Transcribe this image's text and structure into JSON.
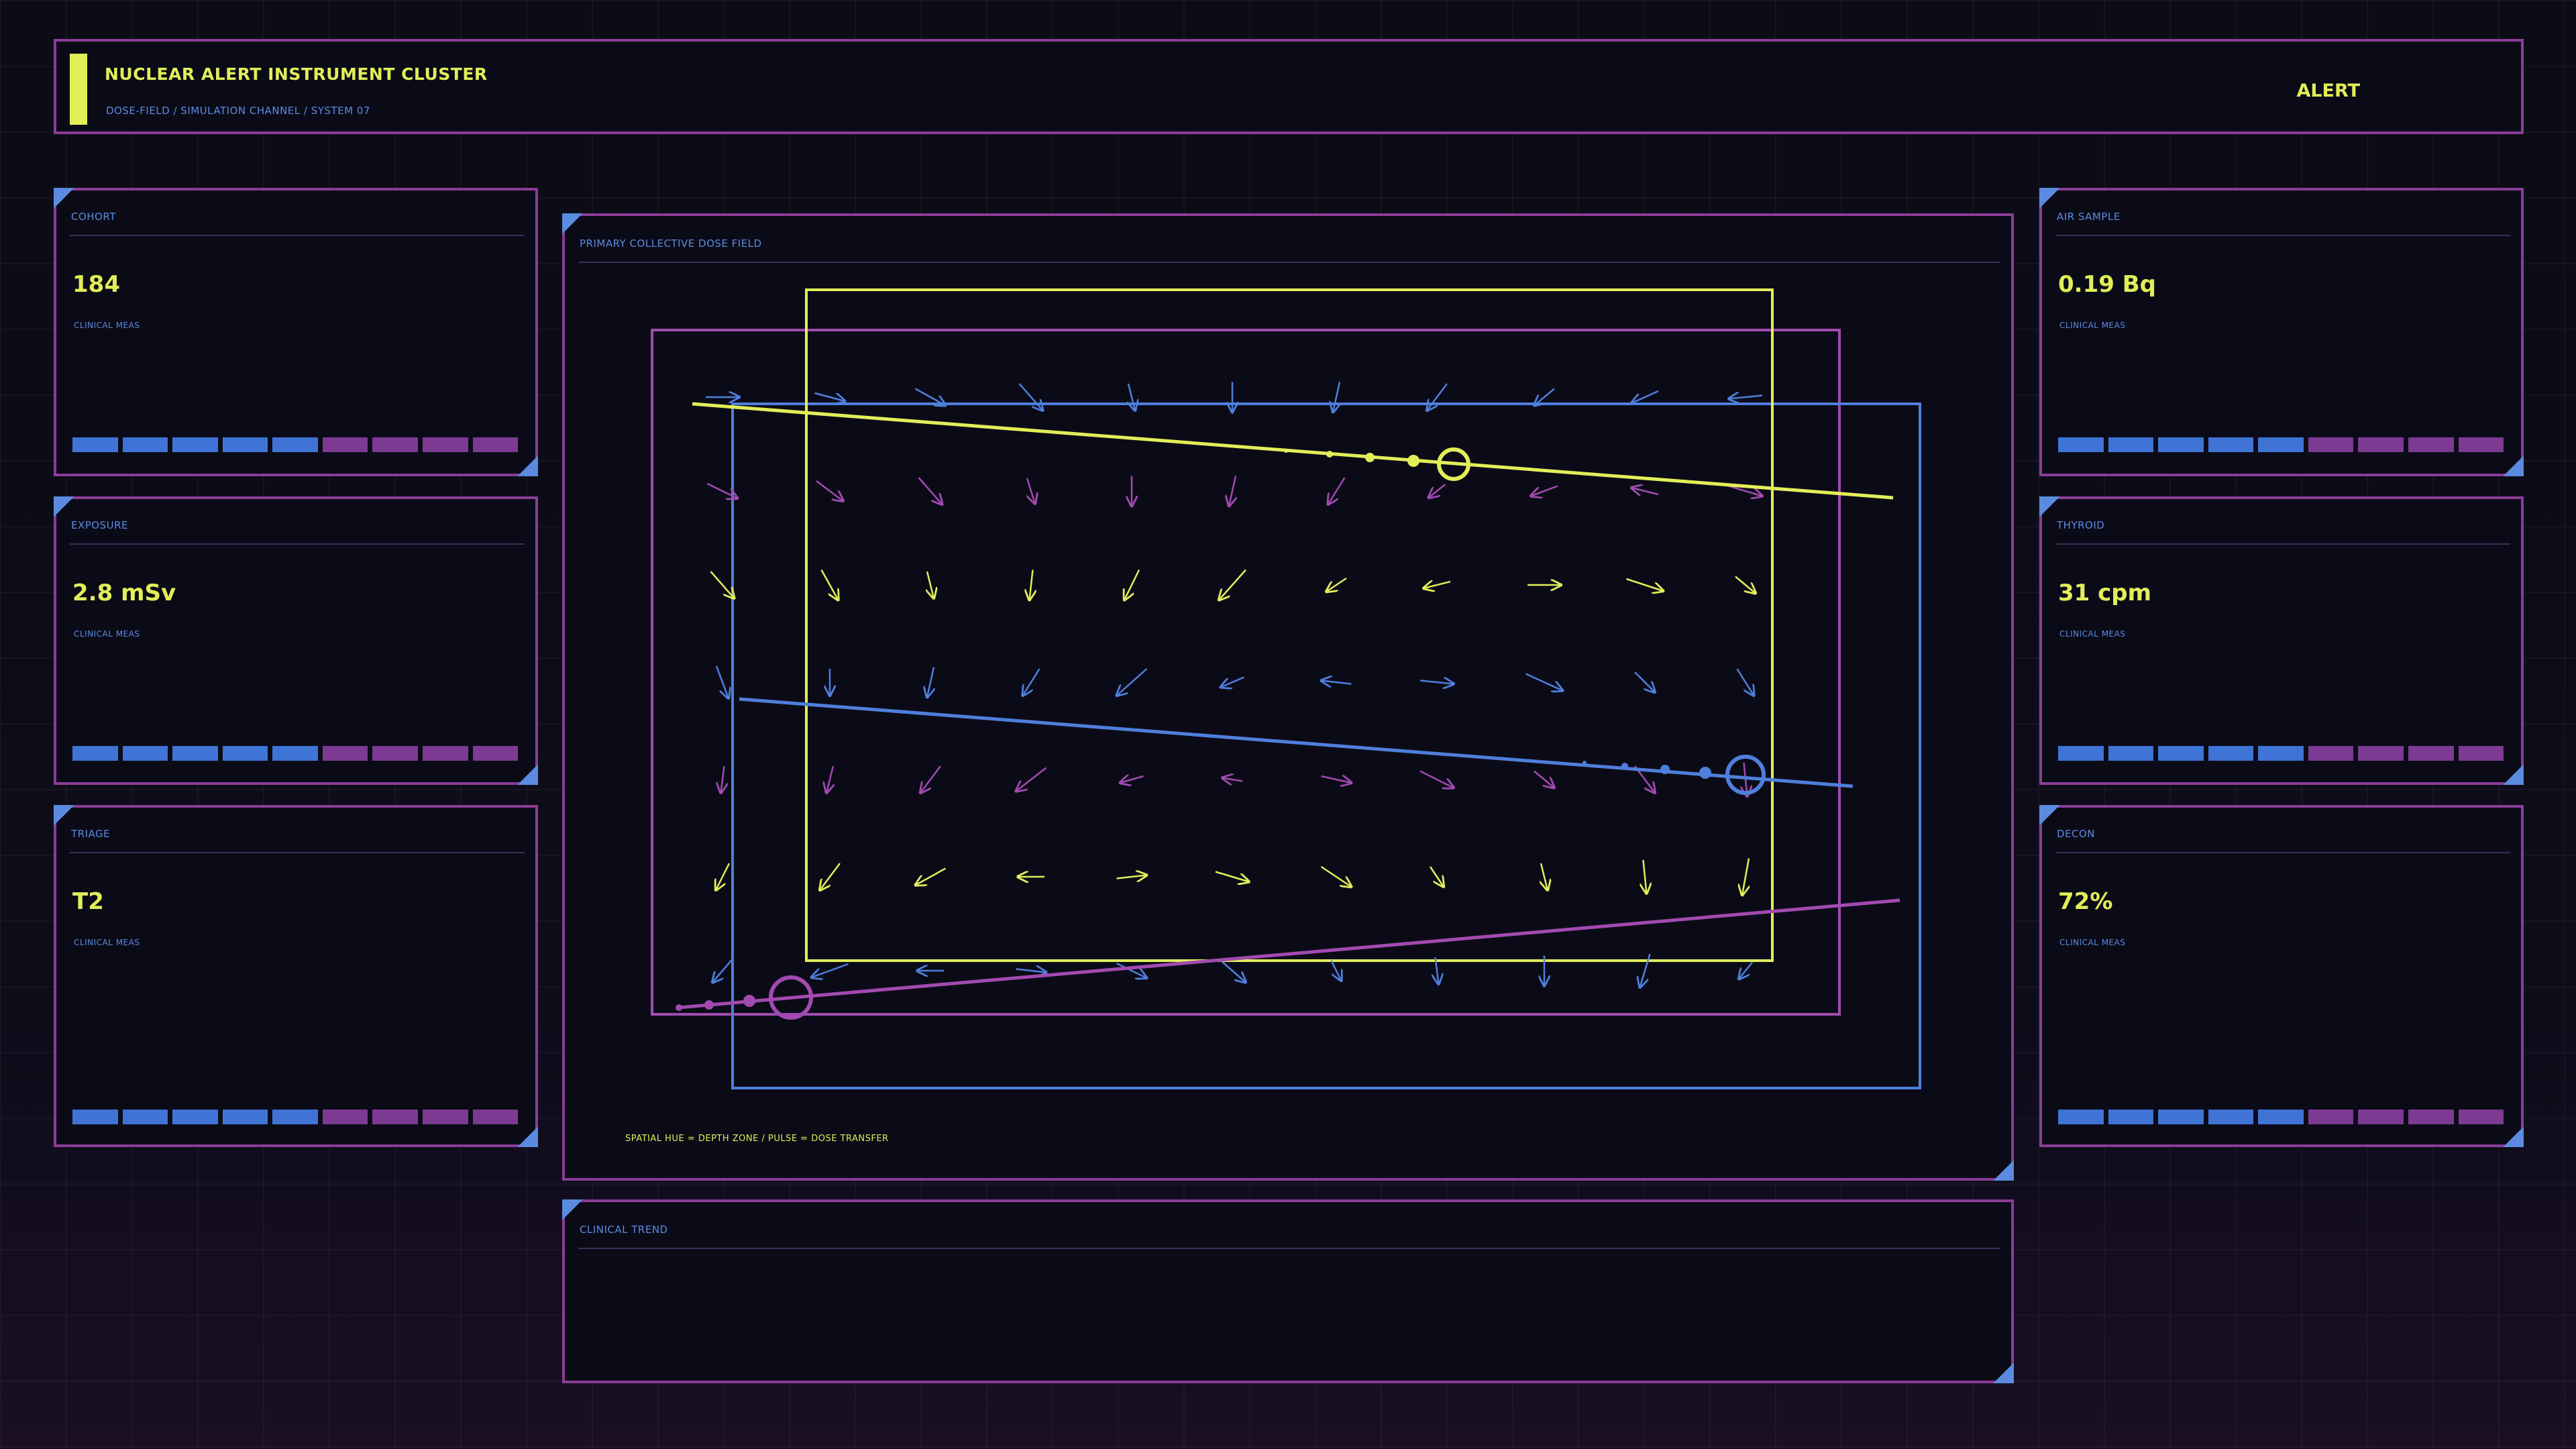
{
  "header": {
    "title": "NUCLEAR ALERT INSTRUMENT CLUSTER",
    "subtitle": "DOSE-FIELD / SIMULATION CHANNEL / SYSTEM 07",
    "status": "ALERT"
  },
  "colors": {
    "yellow": "#e2ee58",
    "blue": "#5b8be0",
    "purple": "#8a3d96",
    "segment_blue": "#3f74d6",
    "segment_purple": "#7d3a93"
  },
  "cards_left": [
    {
      "label": "COHORT",
      "value": "184",
      "sub": "CLINICAL MEAS"
    },
    {
      "label": "EXPOSURE",
      "value": "2.8 mSv",
      "sub": "CLINICAL MEAS"
    },
    {
      "label": "TRIAGE",
      "value": "T2",
      "sub": "CLINICAL MEAS"
    }
  ],
  "cards_right": [
    {
      "label": "AIR SAMPLE",
      "value": "0.19 Bq",
      "sub": "CLINICAL MEAS"
    },
    {
      "label": "THYROID",
      "value": "31 cpm",
      "sub": "CLINICAL MEAS"
    },
    {
      "label": "DECON",
      "value": "72%",
      "sub": "CLINICAL MEAS"
    }
  ],
  "segment_pattern": [
    "blue",
    "blue",
    "blue",
    "blue",
    "blue",
    "purple",
    "purple",
    "purple",
    "purple"
  ],
  "field": {
    "label": "PRIMARY COLLECTIVE DOSE FIELD",
    "legend": "SPATIAL HUE = DEPTH ZONE / PULSE = DOSE TRANSFER"
  },
  "trend": {
    "label": "CLINICAL TREND"
  }
}
